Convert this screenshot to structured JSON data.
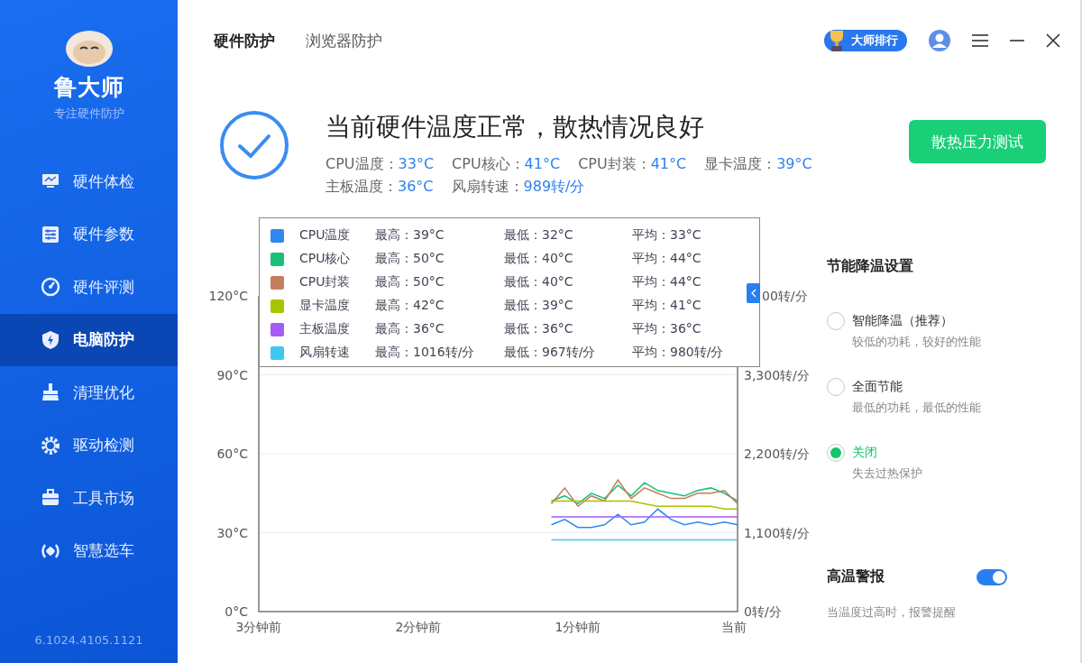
{
  "sidebar": {
    "brand": "鲁大师",
    "slogan": "专注硬件防护",
    "items": [
      {
        "label": "硬件体检",
        "selected": false
      },
      {
        "label": "硬件参数",
        "selected": false
      },
      {
        "label": "硬件评测",
        "selected": false
      },
      {
        "label": "电脑防护",
        "selected": true
      },
      {
        "label": "清理优化",
        "selected": false
      },
      {
        "label": "驱动检测",
        "selected": false
      },
      {
        "label": "工具市场",
        "selected": false
      },
      {
        "label": "智慧选车",
        "selected": false
      }
    ],
    "version": "6.1024.4105.1121"
  },
  "tabs": [
    {
      "label": "硬件防护",
      "selected": true
    },
    {
      "label": "浏览器防护",
      "selected": false
    }
  ],
  "rank_badge": "大师排行",
  "status": {
    "headline": "当前硬件温度正常，散热情况良好",
    "readings": [
      {
        "label": "CPU温度：",
        "value": "33°C"
      },
      {
        "label": "CPU核心：",
        "value": "41°C"
      },
      {
        "label": "CPU封装：",
        "value": "41°C"
      },
      {
        "label": "显卡温度：",
        "value": "39°C"
      },
      {
        "label": "主板温度：",
        "value": "36°C"
      },
      {
        "label": "风扇转速：",
        "value": "989转/分"
      }
    ],
    "button": "散热压力测试"
  },
  "chart": {
    "chart_data": {
      "type": "line",
      "categories": [
        "3分钟前",
        null,
        null,
        null,
        null,
        null,
        null,
        null,
        null,
        null,
        null,
        null,
        "2分钟前",
        null,
        null,
        null,
        null,
        null,
        null,
        null,
        null,
        null,
        null,
        null,
        "1分钟前",
        null,
        null,
        null,
        null,
        null,
        null,
        null,
        null,
        null,
        null,
        null,
        "当前"
      ],
      "grid": true,
      "ylim": [
        0,
        120
      ],
      "y2lim": [
        0,
        4400
      ],
      "y2ticks": [
        {
          "value": 0,
          "label": "0转/分"
        },
        {
          "value": 1100,
          "label": "1,100转/分"
        },
        {
          "value": 2200,
          "label": "2,200转/分"
        },
        {
          "value": 3300,
          "label": "3,300转/分"
        }
      ],
      "yticks": [
        {
          "value": 0,
          "label": "0°C"
        },
        {
          "value": 30,
          "label": "30°C"
        },
        {
          "value": 60,
          "label": "60°C"
        },
        {
          "value": 90,
          "label": "90°C"
        },
        {
          "value": 120,
          "label": "120°C"
        }
      ],
      "series": [
        {
          "name": "CPU温度",
          "color": "#2f87f0",
          "values": [
            null,
            null,
            null,
            null,
            null,
            null,
            null,
            null,
            null,
            null,
            null,
            null,
            null,
            null,
            null,
            null,
            null,
            null,
            null,
            null,
            null,
            null,
            33,
            35,
            32,
            32,
            33,
            37,
            33,
            34,
            39,
            35,
            33,
            34,
            33,
            34,
            33
          ]
        },
        {
          "name": "CPU核心",
          "color": "#19c07a",
          "values": [
            null,
            null,
            null,
            null,
            null,
            null,
            null,
            null,
            null,
            null,
            null,
            null,
            null,
            null,
            null,
            null,
            null,
            null,
            null,
            null,
            null,
            null,
            42,
            44,
            41,
            45,
            43,
            48,
            44,
            49,
            46,
            45,
            44,
            46,
            47,
            45,
            42
          ]
        },
        {
          "name": "CPU封装",
          "color": "#c47f5a",
          "values": [
            null,
            null,
            null,
            null,
            null,
            null,
            null,
            null,
            null,
            null,
            null,
            null,
            null,
            null,
            null,
            null,
            null,
            null,
            null,
            null,
            null,
            null,
            41,
            47,
            40,
            44,
            42,
            50,
            43,
            47,
            45,
            43,
            43,
            45,
            45,
            46,
            41
          ]
        },
        {
          "name": "显卡温度",
          "color": "#a8c400",
          "values": [
            null,
            null,
            null,
            null,
            null,
            null,
            null,
            null,
            null,
            null,
            null,
            null,
            null,
            null,
            null,
            null,
            null,
            null,
            null,
            null,
            null,
            null,
            42,
            42,
            42,
            42,
            42,
            42,
            42,
            41,
            40,
            40,
            40,
            40,
            40,
            39,
            39
          ]
        },
        {
          "name": "主板温度",
          "color": "#a35cf5",
          "values": [
            null,
            null,
            null,
            null,
            null,
            null,
            null,
            null,
            null,
            null,
            null,
            null,
            null,
            null,
            null,
            null,
            null,
            null,
            null,
            null,
            null,
            null,
            36,
            36,
            36,
            36,
            36,
            36,
            36,
            36,
            36,
            36,
            36,
            36,
            36,
            36,
            36
          ]
        },
        {
          "name": "风扇转速",
          "color": "#3ec8f0",
          "axis": "y2",
          "values": [
            null,
            null,
            null,
            null,
            null,
            null,
            null,
            null,
            null,
            null,
            null,
            null,
            null,
            null,
            null,
            null,
            null,
            null,
            null,
            null,
            null,
            null,
            1000,
            1000,
            1000,
            1000,
            1000,
            1000,
            1000,
            1000,
            1000,
            1000,
            1000,
            1000,
            1000,
            1000,
            1000
          ]
        }
      ]
    },
    "right_axis_top_label": "00转/分",
    "legend_stats": [
      {
        "max": "最高：39°C",
        "min": "最低：32°C",
        "avg": "平均：33°C"
      },
      {
        "max": "最高：50°C",
        "min": "最低：40°C",
        "avg": "平均：44°C"
      },
      {
        "max": "最高：50°C",
        "min": "最低：40°C",
        "avg": "平均：44°C"
      },
      {
        "max": "最高：42°C",
        "min": "最低：39°C",
        "avg": "平均：41°C"
      },
      {
        "max": "最高：36°C",
        "min": "最低：36°C",
        "avg": "平均：36°C"
      },
      {
        "max": "最高：1016转/分",
        "min": "最低：967转/分",
        "avg": "平均：980转/分"
      }
    ]
  },
  "settings": {
    "title": "节能降温设置",
    "options": [
      {
        "label": "智能降温（推荐）",
        "description": "较低的功耗，较好的性能",
        "selected": false
      },
      {
        "label": "全面节能",
        "description": "最低的功耗，最低的性能",
        "selected": false
      },
      {
        "label": "关闭",
        "description": "失去过热保护",
        "selected": true
      }
    ],
    "alert": {
      "title": "高温警报",
      "description": "当温度过高时，报警提醒",
      "on": true
    }
  }
}
